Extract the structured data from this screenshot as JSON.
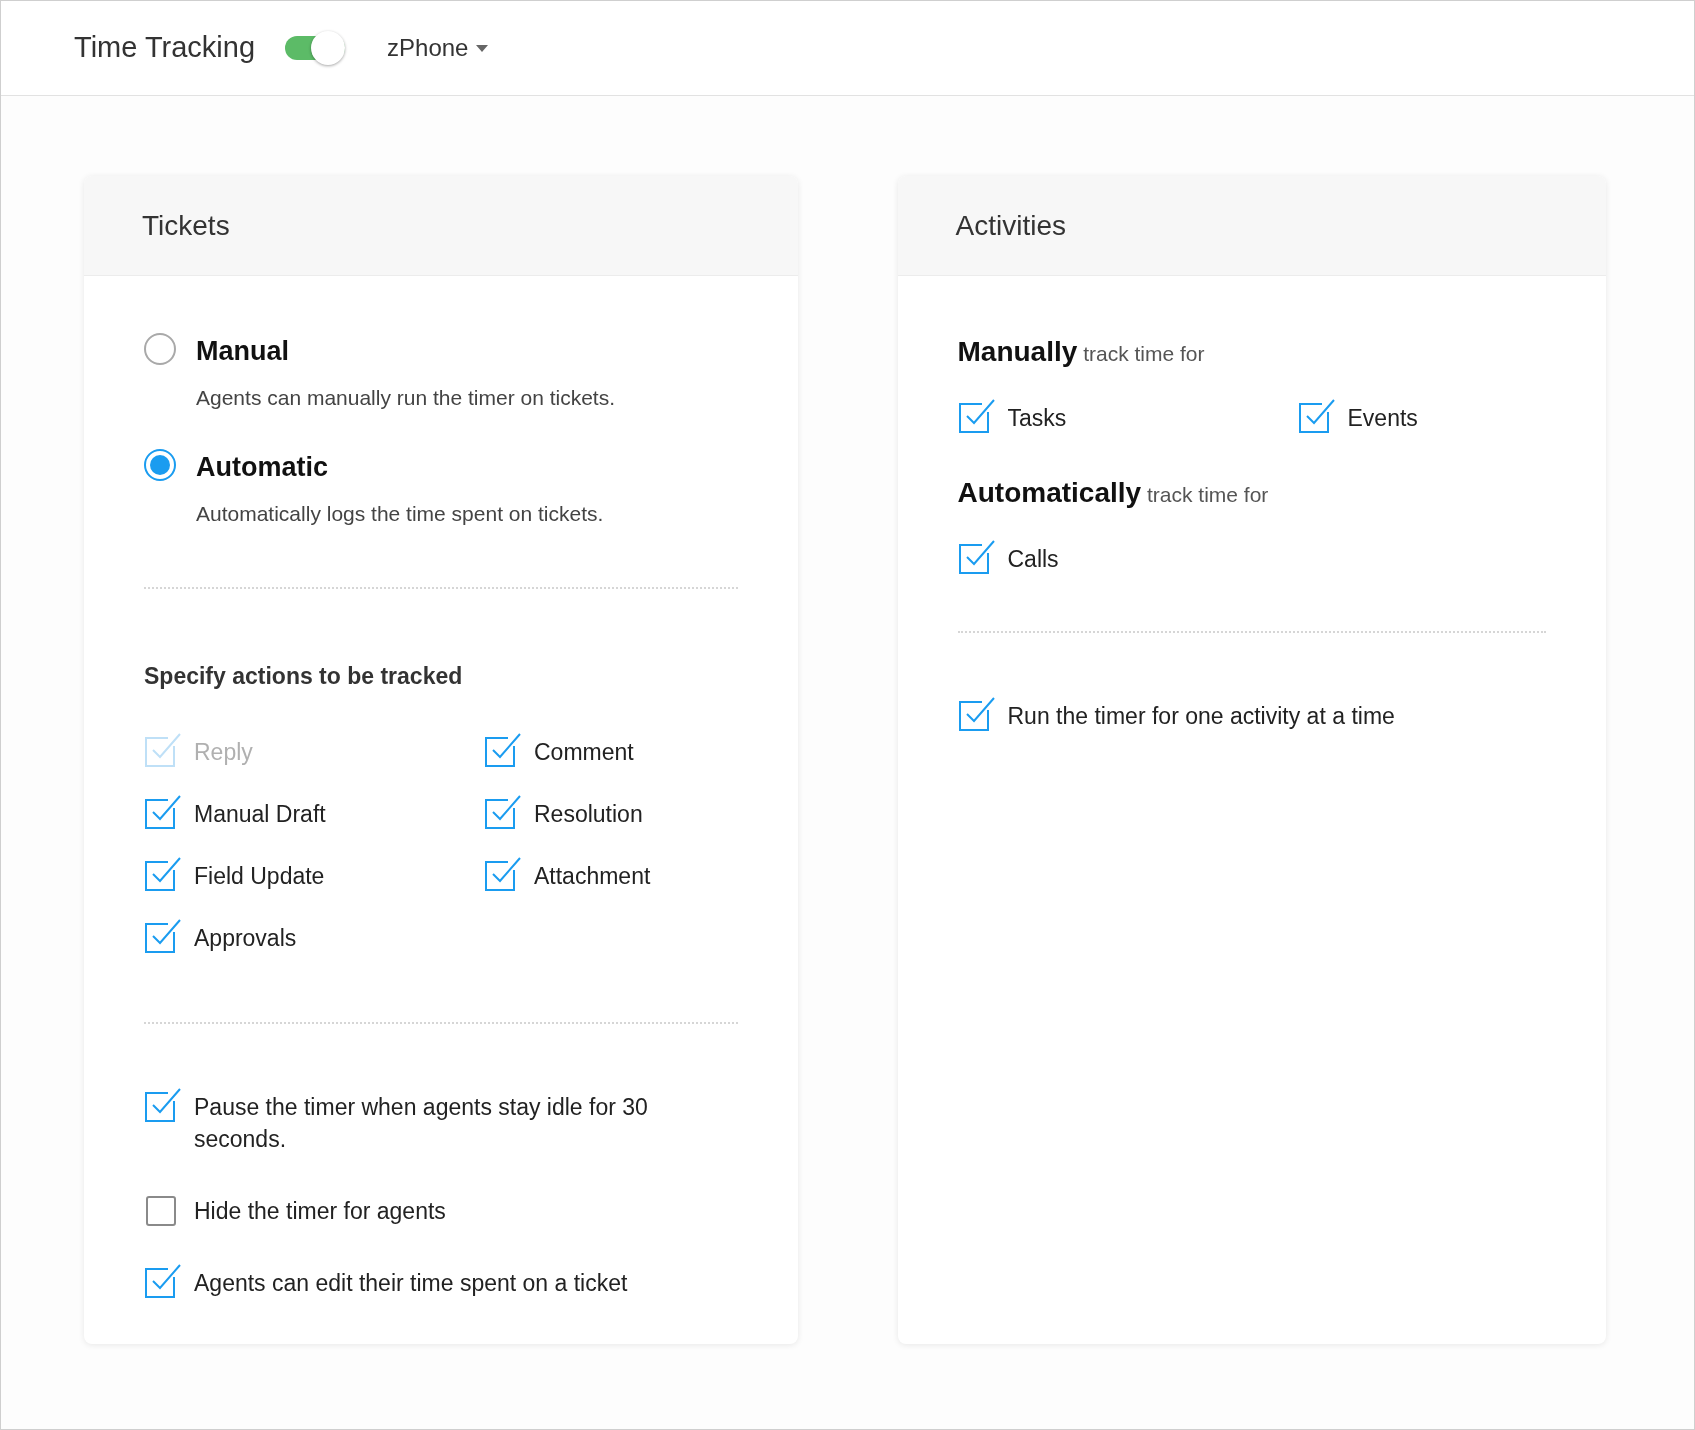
{
  "header": {
    "title": "Time Tracking",
    "toggle_on": true,
    "department": "zPhone"
  },
  "tickets": {
    "title": "Tickets",
    "modes": [
      {
        "label": "Manual",
        "description": "Agents can manually run the timer on tickets.",
        "selected": false
      },
      {
        "label": "Automatic",
        "description": "Automatically logs the time spent on tickets.",
        "selected": true
      }
    ],
    "actions_heading": "Specify actions to be tracked",
    "actions": [
      {
        "label": "Reply",
        "checked": true,
        "disabled": true
      },
      {
        "label": "Comment",
        "checked": true,
        "disabled": false
      },
      {
        "label": "Manual Draft",
        "checked": true,
        "disabled": false
      },
      {
        "label": "Resolution",
        "checked": true,
        "disabled": false
      },
      {
        "label": "Field Update",
        "checked": true,
        "disabled": false
      },
      {
        "label": "Attachment",
        "checked": true,
        "disabled": false
      },
      {
        "label": "Approvals",
        "checked": true,
        "disabled": false
      }
    ],
    "options": [
      {
        "label": "Pause the timer when agents stay idle for 30 seconds.",
        "checked": true
      },
      {
        "label": "Hide the timer for agents",
        "checked": false
      },
      {
        "label": "Agents can edit their time spent on a ticket",
        "checked": true
      }
    ]
  },
  "activities": {
    "title": "Activities",
    "sections": [
      {
        "emphasis": "Manually",
        "label": "track time for",
        "items": [
          {
            "label": "Tasks",
            "checked": true
          },
          {
            "label": "Events",
            "checked": true
          }
        ]
      },
      {
        "emphasis": "Automatically",
        "label": "track time for",
        "items": [
          {
            "label": "Calls",
            "checked": true
          }
        ]
      }
    ],
    "options": [
      {
        "label": "Run the timer for one activity at a time",
        "checked": true
      }
    ]
  }
}
